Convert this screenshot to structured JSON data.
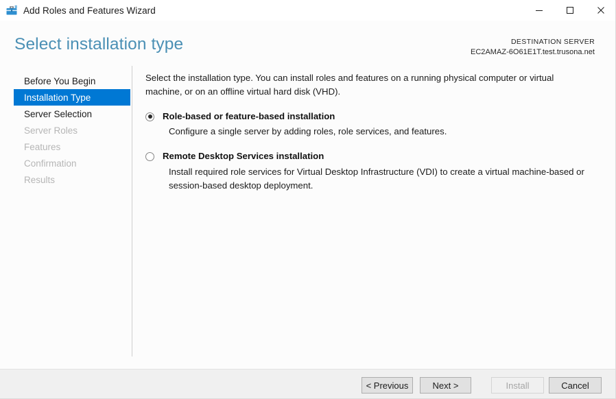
{
  "window": {
    "title": "Add Roles and Features Wizard",
    "icon": "wizard-toolbox-icon",
    "controls": {
      "minimize": "minimize-icon",
      "maximize": "maximize-icon",
      "close": "close-icon"
    }
  },
  "header": {
    "page_title": "Select installation type",
    "destination_label": "DESTINATION SERVER",
    "destination_server": "EC2AMAZ-6O61E1T.test.trusona.net"
  },
  "nav": {
    "items": [
      {
        "label": "Before You Begin",
        "state": "enabled"
      },
      {
        "label": "Installation Type",
        "state": "selected"
      },
      {
        "label": "Server Selection",
        "state": "enabled"
      },
      {
        "label": "Server Roles",
        "state": "disabled"
      },
      {
        "label": "Features",
        "state": "disabled"
      },
      {
        "label": "Confirmation",
        "state": "disabled"
      },
      {
        "label": "Results",
        "state": "disabled"
      }
    ]
  },
  "main": {
    "intro": "Select the installation type. You can install roles and features on a running physical computer or virtual machine, or on an offline virtual hard disk (VHD).",
    "options": [
      {
        "label": "Role-based or feature-based installation",
        "description": "Configure a single server by adding roles, role services, and features.",
        "selected": true
      },
      {
        "label": "Remote Desktop Services installation",
        "description": "Install required role services for Virtual Desktop Infrastructure (VDI) to create a virtual machine-based or session-based desktop deployment.",
        "selected": false
      }
    ]
  },
  "footer": {
    "buttons": [
      {
        "label": "< Previous",
        "enabled": true
      },
      {
        "label": "Next >",
        "enabled": true
      },
      {
        "label": "Install",
        "enabled": false
      },
      {
        "label": "Cancel",
        "enabled": true
      }
    ]
  },
  "colors": {
    "accent": "#0078d4",
    "title_blue": "#4b90b5",
    "footer_bg": "#f0f0f0",
    "disabled_text": "#b6b6b6"
  }
}
